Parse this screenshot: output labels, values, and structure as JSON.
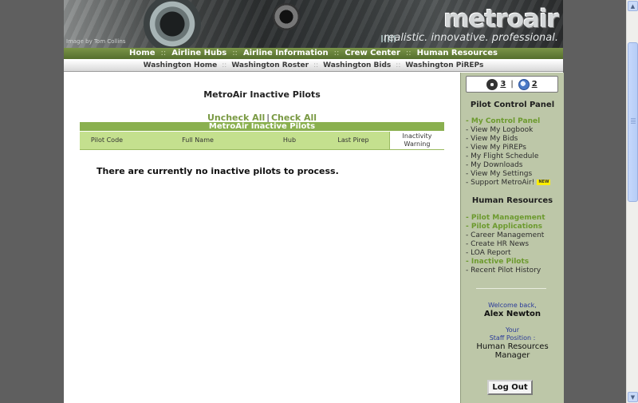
{
  "banner": {
    "photo_credit": "Image by Tom Collins",
    "logo_text": "metroair",
    "tagline": "realistic. innovative. professional."
  },
  "main_nav": {
    "items": [
      "Home",
      "Airline Hubs",
      "Airline Information",
      "Crew Center",
      "Human Resources"
    ],
    "separator": "::"
  },
  "sub_nav": {
    "items": [
      "Washington Home",
      "Washington Roster",
      "Washington Bids",
      "Washington PiREPs"
    ],
    "separator": "::"
  },
  "content": {
    "title": "MetroAir Inactive Pilots",
    "uncheck_all": "Uncheck All",
    "check_all": "Check All",
    "link_separator": "|",
    "table_caption": "MetroAir Inactive Pilots",
    "columns": [
      "Pilot Code",
      "Full Name",
      "Hub",
      "Last Pirep",
      "Inactivity Warning"
    ],
    "empty_message": "There are currently no inactive pilots to process."
  },
  "sidebar": {
    "online_pilots": "3",
    "online_flights": "2",
    "online_separator": "|",
    "pilot_panel_heading": "Pilot Control Panel",
    "pilot_links": [
      {
        "label": "My Control Panel",
        "active": true
      },
      {
        "label": "View My Logbook",
        "active": false
      },
      {
        "label": "View My Bids",
        "active": false
      },
      {
        "label": "View My PiREPs",
        "active": false
      },
      {
        "label": "My Flight Schedule",
        "active": false
      },
      {
        "label": "My Downloads",
        "active": false
      },
      {
        "label": "View My Settings",
        "active": false
      },
      {
        "label": "Support MetroAir!",
        "active": false
      }
    ],
    "new_badge": "NEW",
    "hr_heading": "Human Resources",
    "hr_links": [
      {
        "label": "Pilot Management",
        "active": true
      },
      {
        "label": "Pilot Applications",
        "active": true
      },
      {
        "label": "Career Management",
        "active": false
      },
      {
        "label": "Create HR News",
        "active": false
      },
      {
        "label": "LOA Report",
        "active": false
      },
      {
        "label": "Inactive Pilots",
        "active": true
      },
      {
        "label": "Recent Pilot History",
        "active": false
      }
    ],
    "welcome": "Welcome back,",
    "user_name": "Alex Newton",
    "staff_line1": "Your",
    "staff_line2": "Staff Position :",
    "staff_role": "Human Resources Manager",
    "logout": "Log Out"
  },
  "colors": {
    "nav_green": "#556e2d",
    "table_header": "#c4e08e",
    "table_caption": "#8ab04f",
    "sidebar_bg": "#bdc7a8",
    "active_link": "#6c9a2e"
  }
}
